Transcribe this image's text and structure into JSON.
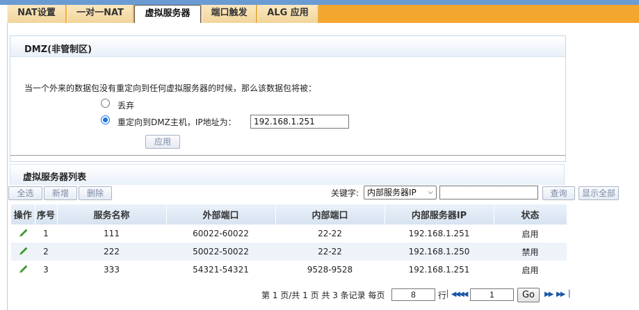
{
  "tabs": [
    {
      "label": "NAT设置",
      "active": false
    },
    {
      "label": "一对一NAT",
      "active": false
    },
    {
      "label": "虚拟服务器",
      "active": true
    },
    {
      "label": "端口触发",
      "active": false
    },
    {
      "label": "ALG 应用",
      "active": false
    }
  ],
  "dmz": {
    "title": "DMZ(非管制区)",
    "description": "当一个外来的数据包没有重定向到任何虚拟服务器的时候，那么该数据包将被：",
    "options": [
      {
        "label": "丢弃",
        "checked": false
      },
      {
        "label": "重定向到DMZ主机，IP地址为：",
        "checked": true
      }
    ],
    "ip_value": "192.168.1.251",
    "apply_label": "应用"
  },
  "vs_list": {
    "title": "虚拟服务器列表",
    "toolbar": {
      "select_all": "全选",
      "add": "新增",
      "delete": "删除",
      "keyword_label": "关键字:",
      "keyword_option": "内部服务器IP",
      "search": "查询",
      "show_all": "显示全部"
    },
    "columns": [
      "操作",
      "序号",
      "服务名称",
      "外部端口",
      "内部端口",
      "内部服务器IP",
      "状态"
    ],
    "rows": [
      {
        "index": "1",
        "name": "111",
        "ext_port": "60022-60022",
        "int_port": "22-22",
        "ip": "192.168.1.251",
        "status": "启用"
      },
      {
        "index": "2",
        "name": "222",
        "ext_port": "50022-50022",
        "int_port": "22-22",
        "ip": "192.168.1.250",
        "status": "禁用"
      },
      {
        "index": "3",
        "name": "333",
        "ext_port": "54321-54321",
        "int_port": "9528-9528",
        "ip": "192.168.1.251",
        "status": "启用"
      }
    ]
  },
  "pager": {
    "summary": "第 1 页/共 1 页 共 3 条记录 每页",
    "per_page": "8",
    "row_unit": "行",
    "page": "1",
    "go_label": "Go"
  },
  "icons": {
    "edit": "pencil-icon",
    "first": "first-page-icon",
    "prev": "prev-page-icon",
    "next": "next-page-icon",
    "last": "last-page-icon"
  },
  "colors": {
    "tab_bar": "#f4a72e",
    "top_line": "#6a9bd2",
    "header_bg": "#d7e3f1",
    "alt_row": "#eef3fa",
    "pencil": "#3a9a2a"
  }
}
